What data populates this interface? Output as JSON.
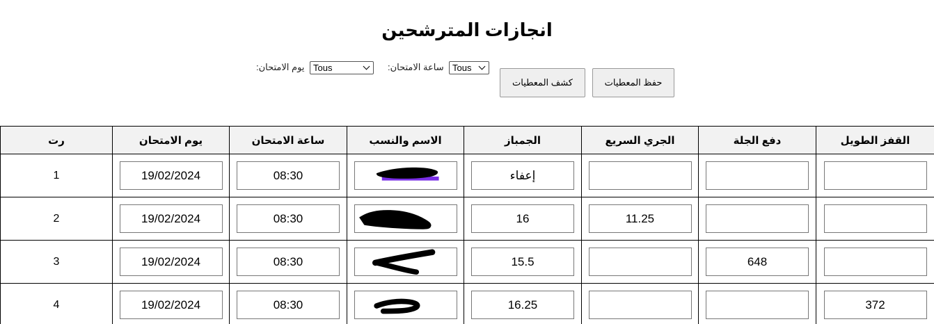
{
  "page": {
    "title": "انجازات المترشحين"
  },
  "filters": {
    "exam_day_label": "يوم الامتحان:",
    "exam_day_value": "Tous",
    "exam_time_label": "ساعة الامتحان:",
    "exam_time_value": "Tous"
  },
  "actions": {
    "show_data_label": "كشف المعطيات",
    "save_data_label": "حفظ المعطيات"
  },
  "table": {
    "columns": [
      "رت",
      "يوم الامتحان",
      "ساعة الامتحان",
      "الاسم والنسب",
      "الجمباز",
      "الجري السريع",
      "دفع الجلة",
      "القفز الطويل"
    ],
    "rows": [
      {
        "num": "1",
        "day": "19/02/2024",
        "time": "08:30",
        "name": "",
        "gym": "إعفاء",
        "sprint": "",
        "shot": "",
        "jump": ""
      },
      {
        "num": "2",
        "day": "19/02/2024",
        "time": "08:30",
        "name": "",
        "gym": "16",
        "sprint": "11.25",
        "shot": "",
        "jump": ""
      },
      {
        "num": "3",
        "day": "19/02/2024",
        "time": "08:30",
        "name": "",
        "gym": "15.5",
        "sprint": "",
        "shot": "648",
        "jump": ""
      },
      {
        "num": "4",
        "day": "19/02/2024",
        "time": "08:30",
        "name": "",
        "gym": "16.25",
        "sprint": "",
        "shot": "",
        "jump": "372"
      }
    ]
  }
}
